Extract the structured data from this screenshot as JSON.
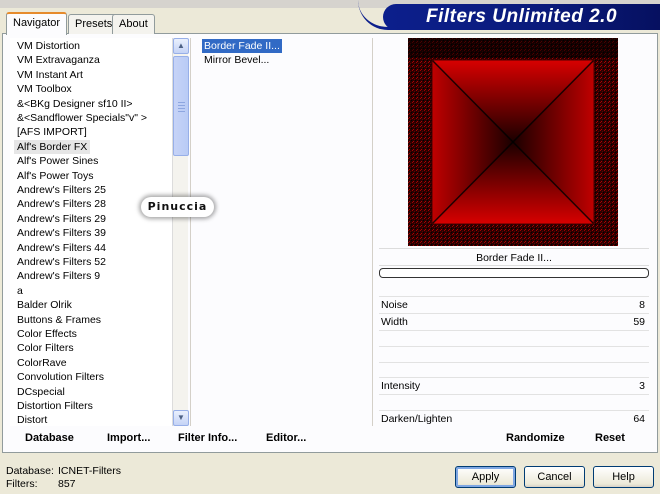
{
  "app": {
    "title": "Filters Unlimited 2.0"
  },
  "tabs": [
    {
      "label": "Navigator",
      "active": true
    },
    {
      "label": "Presets",
      "active": false
    },
    {
      "label": "About",
      "active": false
    }
  ],
  "categories": {
    "items": [
      "VM Distortion",
      "VM Extravaganza",
      "VM Instant Art",
      "VM Toolbox",
      "&<BKg Designer sf10 II>",
      "&<Sandflower Specials\"v\" >",
      "[AFS IMPORT]",
      "Alf's Border FX",
      "Alf's Power Sines",
      "Alf's Power Toys",
      "Andrew's Filters 25",
      "Andrew's Filters 28",
      "Andrew's Filters 29",
      "Andrew's Filters 39",
      "Andrew's Filters 44",
      "Andrew's Filters 52",
      "Andrew's Filters 9",
      "a",
      "Balder Olrik",
      "Buttons & Frames",
      "Color Effects",
      "Color Filters",
      "ColorRave",
      "Convolution Filters",
      "DCspecial",
      "Distortion Filters",
      "Distort"
    ],
    "selected": "Alf's Border FX"
  },
  "filters": {
    "items": [
      "Border Fade II...",
      "Mirror Bevel..."
    ],
    "selected": "Border Fade II..."
  },
  "preview": {
    "label": "Border Fade II...",
    "colors": {
      "frame": "#1a0000",
      "red": "#c40000",
      "dark": "#000000"
    }
  },
  "parameters": [
    {
      "label": "Noise",
      "value": "8"
    },
    {
      "label": "Width",
      "value": "59"
    },
    {
      "label": "Intensity",
      "value": "3"
    },
    {
      "label": "Darken/Lighten",
      "value": "64"
    }
  ],
  "watermark": "Pinuccia",
  "bottom_links": {
    "database": "Database",
    "import": "Import...",
    "filter_info": "Filter Info...",
    "editor": "Editor...",
    "randomize": "Randomize",
    "reset": "Reset"
  },
  "status": {
    "database_label": "Database:",
    "database_value": "ICNET-Filters",
    "filters_label": "Filters:",
    "filters_value": "857"
  },
  "buttons": {
    "apply": "Apply",
    "cancel": "Cancel",
    "help": "Help"
  }
}
